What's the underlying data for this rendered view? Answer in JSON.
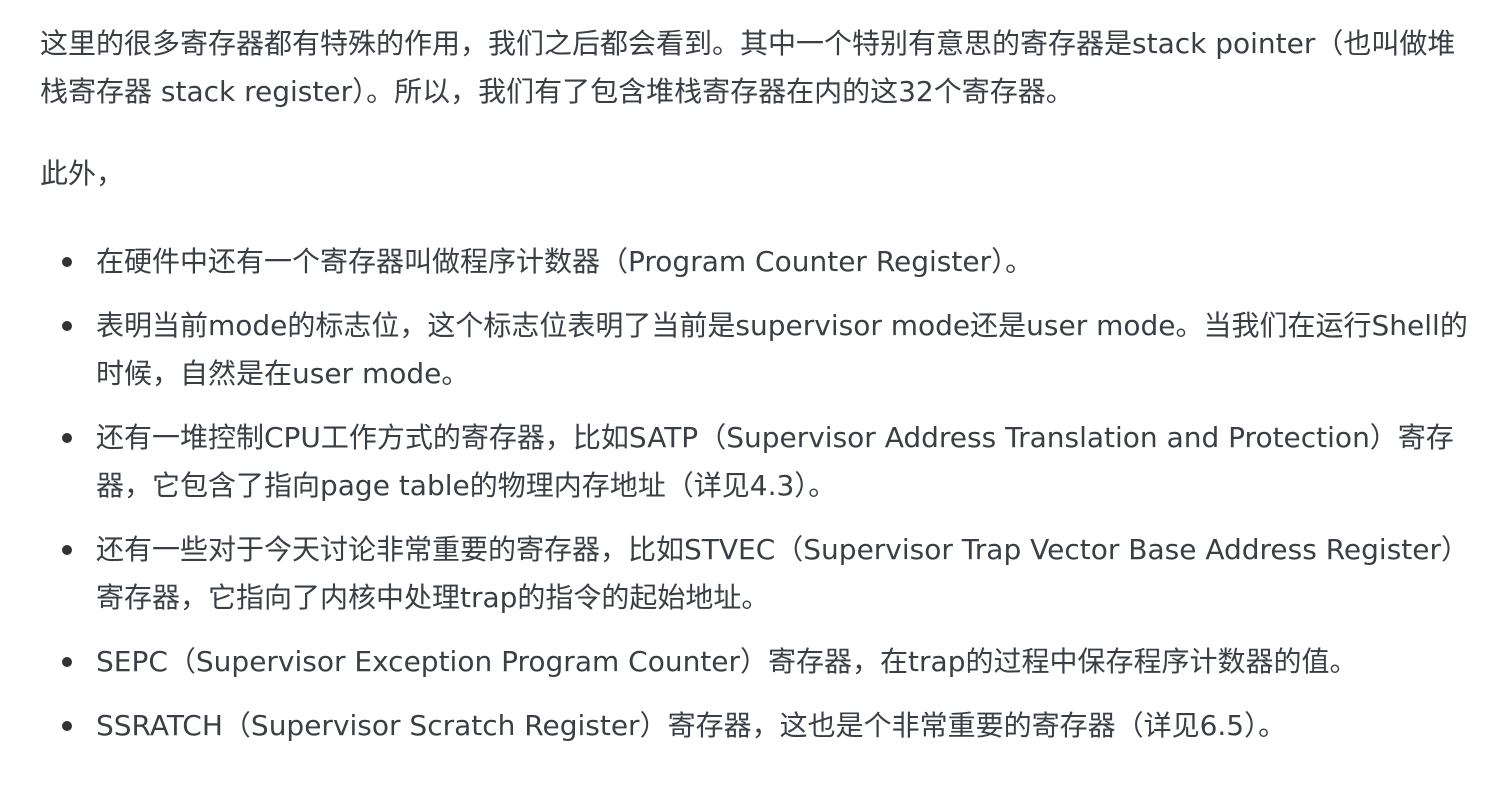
{
  "paragraphs": [
    "这里的很多寄存器都有特殊的作用，我们之后都会看到。其中一个特别有意思的寄存器是stack pointer（也叫做堆栈寄存器 stack register）。所以，我们有了包含堆栈寄存器在内的这32个寄存器。",
    "此外，"
  ],
  "bullets": [
    "在硬件中还有一个寄存器叫做程序计数器（Program Counter Register）。",
    "表明当前mode的标志位，这个标志位表明了当前是supervisor mode还是user mode。当我们在运行Shell的时候，自然是在user mode。",
    "还有一堆控制CPU工作方式的寄存器，比如SATP（Supervisor Address Translation and Protection）寄存器，它包含了指向page table的物理内存地址（详见4.3）。",
    "还有一些对于今天讨论非常重要的寄存器，比如STVEC（Supervisor Trap Vector Base Address Register）寄存器，它指向了内核中处理trap的指令的起始地址。",
    "SEPC（Supervisor Exception Program Counter）寄存器，在trap的过程中保存程序计数器的值。",
    "SSRATCH（Supervisor Scratch Register）寄存器，这也是个非常重要的寄存器（详见6.5）。"
  ]
}
